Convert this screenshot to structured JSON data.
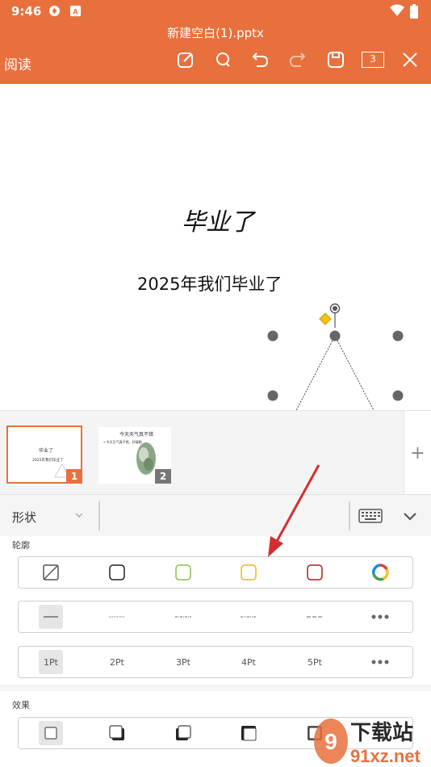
{
  "status_bar": {
    "time": "9:46",
    "left_icons": [
      "sync-icon",
      "a-badge-icon"
    ],
    "right_icons": [
      "wifi-icon",
      "battery-icon"
    ]
  },
  "header": {
    "doc_title": "新建空白(1).pptx",
    "read_mode_label": "阅读",
    "toolbar_icons": [
      "edit-icon",
      "search-icon",
      "undo-icon",
      "redo-icon",
      "save-icon",
      "page-count-icon",
      "close-icon"
    ],
    "page_count": "3",
    "color": "#E8703D"
  },
  "slide": {
    "title": "毕业了",
    "subtitle": "2025年我们毕业了",
    "selected_shape": "triangle"
  },
  "thumbnails": [
    {
      "number": "1",
      "title": "毕业了",
      "subtitle": "2025年我们毕业了",
      "active": true
    },
    {
      "number": "2",
      "title": "今天天气真不错",
      "bullet": "• 今天天气真不错，好晴朗",
      "active": false
    }
  ],
  "add_slide_label": "+",
  "panel": {
    "category_label": "形状",
    "outline_section_label": "轮廓",
    "effect_section_label": "效果",
    "outline_colors": [
      {
        "name": "no-outline-icon",
        "color": "#555555"
      },
      {
        "name": "outline-black",
        "color": "#222222"
      },
      {
        "name": "outline-green",
        "color": "#8BC34A"
      },
      {
        "name": "outline-yellow",
        "color": "#F5B800"
      },
      {
        "name": "outline-red",
        "color": "#B71C1C"
      },
      {
        "name": "more-colors-icon",
        "color": "multicolor"
      }
    ],
    "line_styles": [
      "solid",
      "dotted",
      "dash-dot",
      "dash-dot-dot",
      "dashed",
      "more"
    ],
    "line_widths": [
      "1Pt",
      "2Pt",
      "3Pt",
      "4Pt",
      "5Pt"
    ],
    "effects": [
      "none",
      "shadow-right",
      "shadow-left",
      "shadow-inner-top",
      "shadow-outer"
    ]
  },
  "watermark": {
    "text1": "下载站",
    "text2": "91xz.net"
  }
}
